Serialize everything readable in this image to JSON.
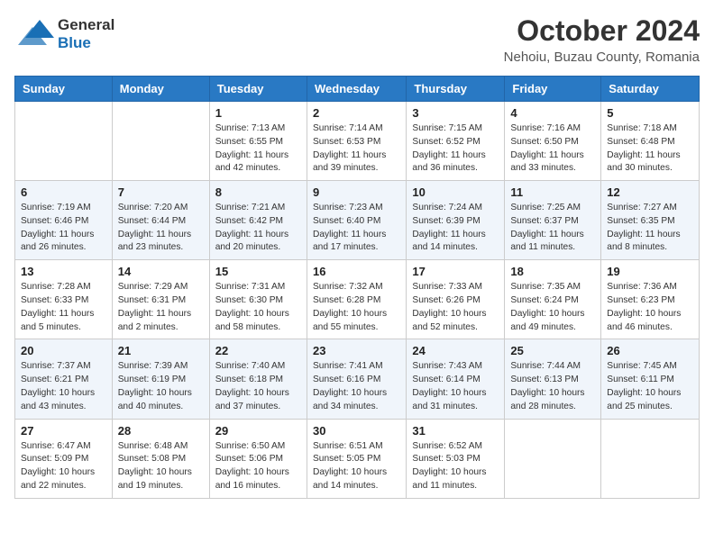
{
  "header": {
    "logo_general": "General",
    "logo_blue": "Blue",
    "month": "October 2024",
    "location": "Nehoiu, Buzau County, Romania"
  },
  "weekdays": [
    "Sunday",
    "Monday",
    "Tuesday",
    "Wednesday",
    "Thursday",
    "Friday",
    "Saturday"
  ],
  "weeks": [
    [
      {
        "day": "",
        "info": ""
      },
      {
        "day": "",
        "info": ""
      },
      {
        "day": "1",
        "info": "Sunrise: 7:13 AM\nSunset: 6:55 PM\nDaylight: 11 hours and 42 minutes."
      },
      {
        "day": "2",
        "info": "Sunrise: 7:14 AM\nSunset: 6:53 PM\nDaylight: 11 hours and 39 minutes."
      },
      {
        "day": "3",
        "info": "Sunrise: 7:15 AM\nSunset: 6:52 PM\nDaylight: 11 hours and 36 minutes."
      },
      {
        "day": "4",
        "info": "Sunrise: 7:16 AM\nSunset: 6:50 PM\nDaylight: 11 hours and 33 minutes."
      },
      {
        "day": "5",
        "info": "Sunrise: 7:18 AM\nSunset: 6:48 PM\nDaylight: 11 hours and 30 minutes."
      }
    ],
    [
      {
        "day": "6",
        "info": "Sunrise: 7:19 AM\nSunset: 6:46 PM\nDaylight: 11 hours and 26 minutes."
      },
      {
        "day": "7",
        "info": "Sunrise: 7:20 AM\nSunset: 6:44 PM\nDaylight: 11 hours and 23 minutes."
      },
      {
        "day": "8",
        "info": "Sunrise: 7:21 AM\nSunset: 6:42 PM\nDaylight: 11 hours and 20 minutes."
      },
      {
        "day": "9",
        "info": "Sunrise: 7:23 AM\nSunset: 6:40 PM\nDaylight: 11 hours and 17 minutes."
      },
      {
        "day": "10",
        "info": "Sunrise: 7:24 AM\nSunset: 6:39 PM\nDaylight: 11 hours and 14 minutes."
      },
      {
        "day": "11",
        "info": "Sunrise: 7:25 AM\nSunset: 6:37 PM\nDaylight: 11 hours and 11 minutes."
      },
      {
        "day": "12",
        "info": "Sunrise: 7:27 AM\nSunset: 6:35 PM\nDaylight: 11 hours and 8 minutes."
      }
    ],
    [
      {
        "day": "13",
        "info": "Sunrise: 7:28 AM\nSunset: 6:33 PM\nDaylight: 11 hours and 5 minutes."
      },
      {
        "day": "14",
        "info": "Sunrise: 7:29 AM\nSunset: 6:31 PM\nDaylight: 11 hours and 2 minutes."
      },
      {
        "day": "15",
        "info": "Sunrise: 7:31 AM\nSunset: 6:30 PM\nDaylight: 10 hours and 58 minutes."
      },
      {
        "day": "16",
        "info": "Sunrise: 7:32 AM\nSunset: 6:28 PM\nDaylight: 10 hours and 55 minutes."
      },
      {
        "day": "17",
        "info": "Sunrise: 7:33 AM\nSunset: 6:26 PM\nDaylight: 10 hours and 52 minutes."
      },
      {
        "day": "18",
        "info": "Sunrise: 7:35 AM\nSunset: 6:24 PM\nDaylight: 10 hours and 49 minutes."
      },
      {
        "day": "19",
        "info": "Sunrise: 7:36 AM\nSunset: 6:23 PM\nDaylight: 10 hours and 46 minutes."
      }
    ],
    [
      {
        "day": "20",
        "info": "Sunrise: 7:37 AM\nSunset: 6:21 PM\nDaylight: 10 hours and 43 minutes."
      },
      {
        "day": "21",
        "info": "Sunrise: 7:39 AM\nSunset: 6:19 PM\nDaylight: 10 hours and 40 minutes."
      },
      {
        "day": "22",
        "info": "Sunrise: 7:40 AM\nSunset: 6:18 PM\nDaylight: 10 hours and 37 minutes."
      },
      {
        "day": "23",
        "info": "Sunrise: 7:41 AM\nSunset: 6:16 PM\nDaylight: 10 hours and 34 minutes."
      },
      {
        "day": "24",
        "info": "Sunrise: 7:43 AM\nSunset: 6:14 PM\nDaylight: 10 hours and 31 minutes."
      },
      {
        "day": "25",
        "info": "Sunrise: 7:44 AM\nSunset: 6:13 PM\nDaylight: 10 hours and 28 minutes."
      },
      {
        "day": "26",
        "info": "Sunrise: 7:45 AM\nSunset: 6:11 PM\nDaylight: 10 hours and 25 minutes."
      }
    ],
    [
      {
        "day": "27",
        "info": "Sunrise: 6:47 AM\nSunset: 5:09 PM\nDaylight: 10 hours and 22 minutes."
      },
      {
        "day": "28",
        "info": "Sunrise: 6:48 AM\nSunset: 5:08 PM\nDaylight: 10 hours and 19 minutes."
      },
      {
        "day": "29",
        "info": "Sunrise: 6:50 AM\nSunset: 5:06 PM\nDaylight: 10 hours and 16 minutes."
      },
      {
        "day": "30",
        "info": "Sunrise: 6:51 AM\nSunset: 5:05 PM\nDaylight: 10 hours and 14 minutes."
      },
      {
        "day": "31",
        "info": "Sunrise: 6:52 AM\nSunset: 5:03 PM\nDaylight: 10 hours and 11 minutes."
      },
      {
        "day": "",
        "info": ""
      },
      {
        "day": "",
        "info": ""
      }
    ]
  ]
}
